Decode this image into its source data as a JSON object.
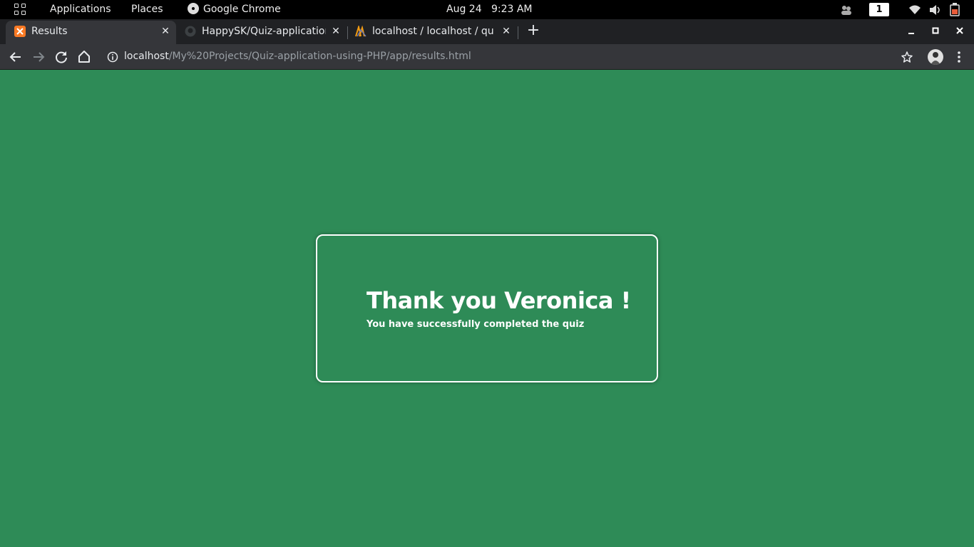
{
  "system_bar": {
    "applications": "Applications",
    "places": "Places",
    "app_name": "Google Chrome",
    "date": "Aug 24",
    "time": "9:23 AM",
    "workspace": "1"
  },
  "browser": {
    "tabs": [
      {
        "title": "Results",
        "favicon": "xampp-icon",
        "active": true
      },
      {
        "title": "HappySK/Quiz-application",
        "favicon": "github-icon",
        "active": false
      },
      {
        "title": "localhost / localhost / quiz",
        "favicon": "phpmyadmin-icon",
        "active": false
      }
    ],
    "url_host": "localhost",
    "url_path": "/My%20Projects/Quiz-application-using-PHP/app/results.html"
  },
  "page": {
    "heading": "Thank you Veronica !",
    "message": "You have successfully completed the quiz",
    "background_color": "#2e8b57"
  }
}
